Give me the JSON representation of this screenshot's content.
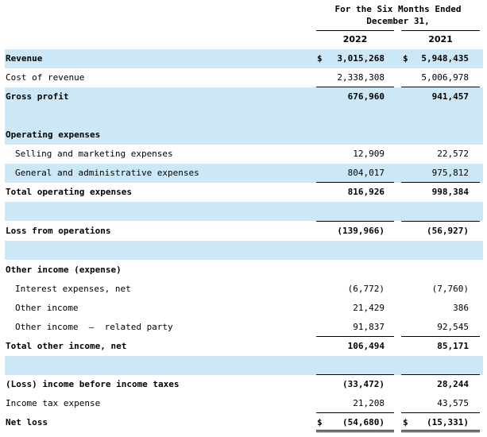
{
  "header": {
    "period_line1": "For the Six  Months Ended",
    "period_line2": "December  31,",
    "year1": "2022",
    "year2": "2021"
  },
  "rows": [
    {
      "label": "Revenue",
      "v2022": "3,015,268",
      "v2021": "5,948,435",
      "bold": true,
      "currency": true
    },
    {
      "label": "Cost of revenue",
      "v2022": "2,338,308",
      "v2021": "5,006,978"
    },
    {
      "label": "Gross profit",
      "v2022": "676,960",
      "v2021": "941,457",
      "bold": true
    },
    {
      "label": "Operating expenses",
      "bold": true
    },
    {
      "label": "Selling and marketing expenses",
      "v2022": "12,909",
      "v2021": "22,572",
      "indent": true
    },
    {
      "label": "General and administrative expenses",
      "v2022": "804,017",
      "v2021": "975,812",
      "indent": true
    },
    {
      "label": "Total operating expenses",
      "v2022": "816,926",
      "v2021": "998,384",
      "bold": true
    },
    {
      "label": "Loss from operations",
      "v2022": "(139,966)",
      "v2021": "(56,927)",
      "bold": true
    },
    {
      "label": "Other income (expense)",
      "bold": true
    },
    {
      "label": "Interest expenses, net",
      "v2022": "(6,772)",
      "v2021": "(7,760)",
      "indent": true
    },
    {
      "label": "Other income",
      "v2022": "21,429",
      "v2021": "386",
      "indent": true
    },
    {
      "label": "Other income  –  related party",
      "v2022": "91,837",
      "v2021": "92,545",
      "indent": true
    },
    {
      "label": "Total other income, net",
      "v2022": "106,494",
      "v2021": "85,171",
      "bold": true
    },
    {
      "label": "(Loss) income before income taxes",
      "v2022": "(33,472)",
      "v2021": "28,244",
      "bold": true
    },
    {
      "label": "Income tax expense",
      "v2022": "21,208",
      "v2021": "43,575"
    },
    {
      "label": "Net loss",
      "v2022": "(54,680)",
      "v2021": "(15,331)",
      "bold": true,
      "currency": true
    }
  ],
  "currency_symbol": "$"
}
